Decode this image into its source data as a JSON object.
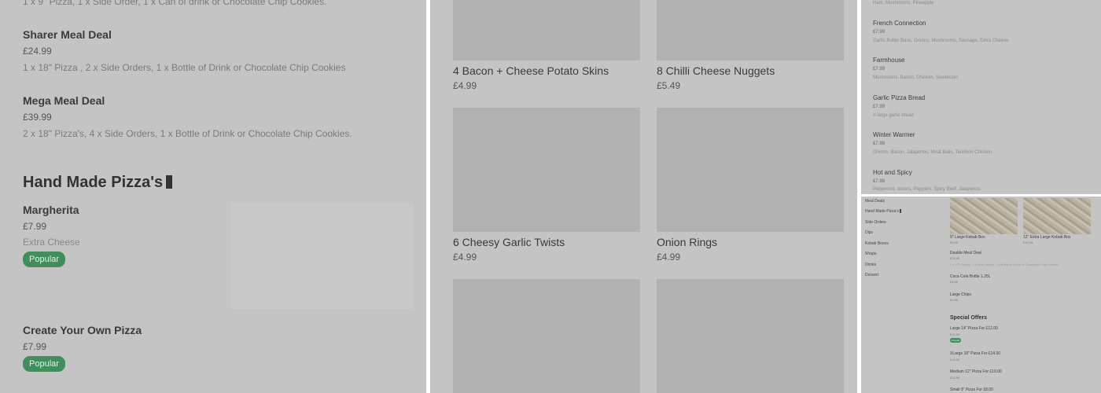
{
  "panel1": {
    "top_desc": "1 x 9\" Pizza, 1 x Side Order, 1 x Can of drink or Chocolate Chip Cookies.",
    "sharer": {
      "name": "Sharer Meal Deal",
      "price": "£24.99",
      "desc": "1 x 18\" Pizza , 2 x Side Orders, 1 x Bottle of Drink or Chocolate Chip Cookies"
    },
    "mega": {
      "name": "Mega Meal Deal",
      "price": "£39.99",
      "desc": "2 x 18\" Pizza's, 4 x Side Orders, 1 x Bottle of Drink or Chocolate Chip Cookies."
    },
    "section_title": "Hand Made Pizza's",
    "margherita": {
      "name": "Margherita",
      "price": "£7.99",
      "desc": "Extra Cheese",
      "badge": "Popular"
    },
    "create": {
      "name": "Create Your Own Pizza",
      "price": "£7.99",
      "badge": "Popular"
    }
  },
  "panel2": {
    "items": [
      {
        "name": "4 Bacon + Cheese Potato Skins",
        "price": "£4.99"
      },
      {
        "name": "8 Chilli Cheese Nuggets",
        "price": "£5.49"
      },
      {
        "name": "6 Cheesy Garlic Twists",
        "price": "£4.99"
      },
      {
        "name": "Onion Rings",
        "price": "£4.99"
      }
    ]
  },
  "panel3": {
    "top_desc": "Ham, Mushrooms, Pineapple",
    "items": [
      {
        "name": "French Connection",
        "price": "£7.99",
        "desc": "Garlic Butter Base, Onions, Mushrooms, Sausage, Extra Cheese"
      },
      {
        "name": "Farmhouse",
        "price": "£7.99",
        "desc": "Mushrooms, Bacon, Chicken, Sweetcorn"
      },
      {
        "name": "Garlic Pizza Bread",
        "price": "£7.99",
        "desc": "A large garlic bread"
      },
      {
        "name": "Winter Warmer",
        "price": "£7.99",
        "desc": "Onions, Bacon, Jalapenos, Meat Balls, Tandoori Chicken"
      },
      {
        "name": "Hot and Spicy",
        "price": "£7.99",
        "desc": "Pepperoni, onions, Peppers, Spicy Beef, Jalapenos"
      }
    ]
  },
  "panel4": {
    "nav": [
      "Meal Deals",
      "Hand Made Pizza's",
      "Side Orders",
      "Dips",
      "Kebab Boxes",
      "Wraps",
      "Drinks",
      "Dessert"
    ],
    "kebab1": {
      "name": "9\" Large Kebab Box",
      "price": "£9.99"
    },
    "kebab2": {
      "name": "12\" Extra Large Kebab Box",
      "price": "£12.99"
    },
    "double": {
      "name": "Double Meal Deal",
      "price": "£25.99",
      "desc": "2 x 12\" Pizza's, 2 x Side Orders, 1 x Bottle of Drink or Chocolate Chip Cookies"
    },
    "coca": {
      "name": "Coca Cola Bottle 1.25L",
      "price": "£3.49"
    },
    "chips": {
      "name": "Large Chips",
      "price": "£2.99"
    },
    "offers_title": "Special Offers",
    "offer1": {
      "name": "Large 14\" Pizza For £12.00",
      "price": "£12.00",
      "badge": "Popular"
    },
    "offer2": {
      "name": "XLarge 18\" Pizza For £14.00",
      "price": "£14.00"
    },
    "offer3": {
      "name": "Medium 12\" Pizza For £10.00",
      "price": "£10.00"
    },
    "offer4": {
      "name": "Small 9\" Pizza For £8.00"
    }
  },
  "colors": {
    "overlay": "#c4c4c4",
    "popular_badge": "#3f8e5c",
    "tile": "#b1b1b1"
  }
}
